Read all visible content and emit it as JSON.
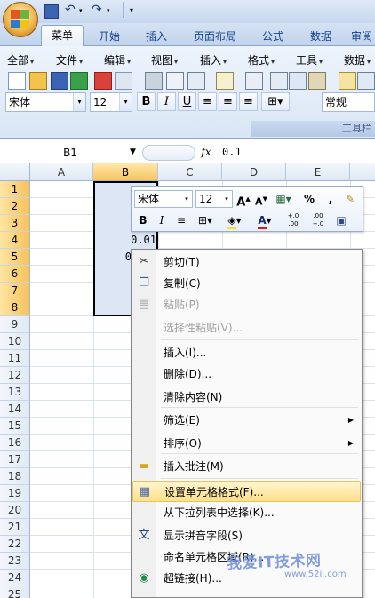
{
  "ribbon": {
    "tabs": [
      "菜单",
      "开始",
      "插入",
      "页面布局",
      "公式",
      "数据",
      "审阅"
    ],
    "active_tab": "菜单",
    "menus": [
      "全部",
      "文件",
      "编辑",
      "视图",
      "插入",
      "格式",
      "工具",
      "数据"
    ],
    "font_name": "宋体",
    "font_size": "12",
    "number_format": "常规",
    "group_label": "工具栏",
    "bold": "B",
    "italic": "I",
    "underline": "U"
  },
  "formula_bar": {
    "name_box": "B1",
    "fx": "fx",
    "value": "0.1"
  },
  "sheet": {
    "columns": [
      "A",
      "B",
      "C",
      "D",
      "E"
    ],
    "selected_column": "B",
    "rows": [
      "1",
      "2",
      "3",
      "4",
      "5",
      "6",
      "7",
      "8",
      "9",
      "10",
      "11",
      "12",
      "13",
      "14",
      "15",
      "16",
      "17",
      "18",
      "19",
      "20",
      "21",
      "22",
      "23",
      "24",
      "25"
    ],
    "visible_values": {
      "B4": "0.01",
      "B5": "0"
    }
  },
  "mini_toolbar": {
    "font_name": "宋体",
    "font_size": "12",
    "grow_font": "A",
    "shrink_font": "A",
    "percent": "%",
    "comma": ",",
    "bold": "B",
    "italic": "I",
    "font_color": "A",
    "inc_decimal": "+.0 .00",
    "dec_decimal": ".00 +.0"
  },
  "context_menu": {
    "items": [
      {
        "label": "剪切(T)",
        "icon": "scissors-icon",
        "disabled": false
      },
      {
        "label": "复制(C)",
        "icon": "copy-icon",
        "disabled": false
      },
      {
        "label": "粘贴(P)",
        "icon": "paste-icon",
        "disabled": true
      },
      {
        "label": "选择性粘贴(V)...",
        "icon": "",
        "disabled": true
      },
      {
        "label": "插入(I)...",
        "icon": "",
        "disabled": false
      },
      {
        "label": "删除(D)...",
        "icon": "",
        "disabled": false
      },
      {
        "label": "清除内容(N)",
        "icon": "",
        "disabled": false
      },
      {
        "label": "筛选(E)",
        "icon": "",
        "disabled": false,
        "submenu": true
      },
      {
        "label": "排序(O)",
        "icon": "",
        "disabled": false,
        "submenu": true
      },
      {
        "label": "插入批注(M)",
        "icon": "comment-icon",
        "disabled": false
      },
      {
        "label": "设置单元格格式(F)...",
        "icon": "format-cells-icon",
        "disabled": false,
        "highlighted": true
      },
      {
        "label": "从下拉列表中选择(K)...",
        "icon": "",
        "disabled": false
      },
      {
        "label": "显示拼音字段(S)",
        "icon": "phonetic-icon",
        "disabled": false
      },
      {
        "label": "命名单元格区域(R)...",
        "icon": "",
        "disabled": false
      },
      {
        "label": "超链接(H)...",
        "icon": "hyperlink-icon",
        "disabled": false
      }
    ]
  },
  "watermark": {
    "text": "我爱IT技术网",
    "url": "www.52ij.com"
  },
  "colors": {
    "accent": "#15428b",
    "selection": "#dde6f5",
    "header_selected": "#f7c45f",
    "menu_highlight": "#ffe08a"
  }
}
